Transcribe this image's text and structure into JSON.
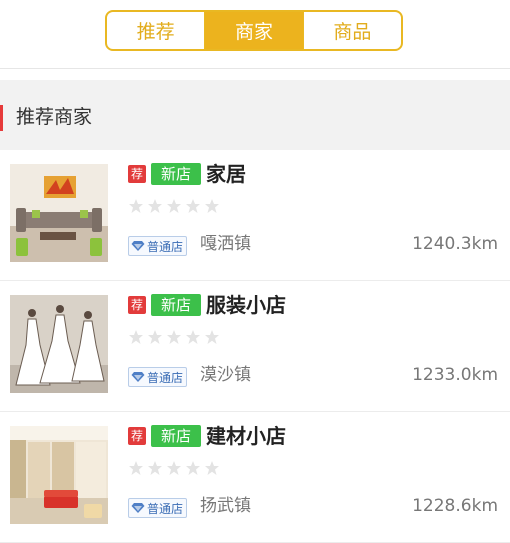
{
  "tabs": [
    {
      "label": "推荐",
      "active": false
    },
    {
      "label": "商家",
      "active": true
    },
    {
      "label": "商品",
      "active": false
    }
  ],
  "section": {
    "title": "推荐商家"
  },
  "shops": [
    {
      "rec_badge": "荐",
      "new_badge": "新店",
      "name": "家居",
      "rating": 0,
      "level": "普通店",
      "town": "嘎洒镇",
      "distance": "1240.3km",
      "thumb": "living-room-photo"
    },
    {
      "rec_badge": "荐",
      "new_badge": "新店",
      "name": "服装小店",
      "rating": 0,
      "level": "普通店",
      "town": "漠沙镇",
      "distance": "1233.0km",
      "thumb": "dresses-sketch-photo"
    },
    {
      "rec_badge": "荐",
      "new_badge": "新店",
      "name": "建材小店",
      "rating": 0,
      "level": "普通店",
      "town": "扬武镇",
      "distance": "1228.6km",
      "thumb": "showroom-photo"
    }
  ],
  "colors": {
    "accent": "#ecb31e",
    "rec": "#e23b3b",
    "new": "#3cc04a",
    "section_bar": "#e63a3a",
    "star_empty": "#e3e3e3"
  }
}
